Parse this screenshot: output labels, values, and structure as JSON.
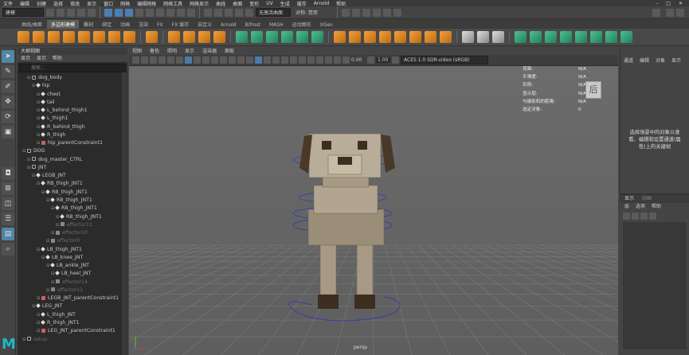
{
  "menubar": {
    "items": [
      "文件",
      "编辑",
      "创建",
      "选择",
      "修改",
      "显示",
      "窗口",
      "网格",
      "编辑网格",
      "网格工具",
      "网格显示",
      "曲线",
      "曲面",
      "变形",
      "UV",
      "生成",
      "缓存",
      "Arnold",
      "帮助"
    ]
  },
  "statusline": {
    "mode": "建模",
    "live_surface": "无激活曲面",
    "symmetry": "对称: 禁用"
  },
  "shelf": {
    "tabs": [
      "曲线/曲面",
      "多边形建模",
      "雕刻",
      "绑定",
      "动画",
      "渲染",
      "FX",
      "FX 缓存",
      "自定义",
      "Arnold",
      "Bifrost",
      "MASH",
      "运动图形",
      "XGen"
    ],
    "active_tab": "多边形建模"
  },
  "outliner": {
    "title": "大纲视图",
    "menu": [
      "显示",
      "显示",
      "帮助"
    ],
    "search_placeholder": "搜索...",
    "rows": [
      {
        "label": "dog_body",
        "depth": 2,
        "icon": "xf",
        "dim": false
      },
      {
        "label": "hip",
        "depth": 3,
        "icon": "joint",
        "dim": false
      },
      {
        "label": "chest",
        "depth": 4,
        "icon": "joint",
        "dim": false
      },
      {
        "label": "tail",
        "depth": 4,
        "icon": "joint",
        "dim": false
      },
      {
        "label": "L_behind_thigh1",
        "depth": 4,
        "icon": "joint",
        "dim": false
      },
      {
        "label": "L_thigh1",
        "depth": 4,
        "icon": "joint",
        "dim": false
      },
      {
        "label": "R_behind_thigh",
        "depth": 4,
        "icon": "joint",
        "dim": false
      },
      {
        "label": "R_thigh",
        "depth": 4,
        "icon": "joint",
        "dim": false
      },
      {
        "label": "hip_parentConstraint1",
        "depth": 4,
        "icon": "con",
        "dim": false
      },
      {
        "label": "DOG",
        "depth": 1,
        "icon": "xf",
        "dim": false
      },
      {
        "label": "dog_master_CTRL",
        "depth": 2,
        "icon": "xf",
        "dim": false
      },
      {
        "label": "JNT",
        "depth": 2,
        "icon": "xf",
        "dim": false
      },
      {
        "label": "LEGB_JNT",
        "depth": 3,
        "icon": "joint",
        "dim": false
      },
      {
        "label": "RB_thigh_JNT1",
        "depth": 4,
        "icon": "joint",
        "dim": false
      },
      {
        "label": "RB_thigh_JNT1",
        "depth": 5,
        "icon": "joint",
        "dim": false
      },
      {
        "label": "RB_thigh_JNT1",
        "depth": 6,
        "icon": "joint",
        "dim": false
      },
      {
        "label": "RB_thigh_JNT1",
        "depth": 7,
        "icon": "joint",
        "dim": false
      },
      {
        "label": "RB_thigh_JNT1",
        "depth": 8,
        "icon": "joint",
        "dim": false
      },
      {
        "label": "effector11",
        "depth": 8,
        "icon": "eff",
        "dim": true
      },
      {
        "label": "effector10",
        "depth": 7,
        "icon": "eff",
        "dim": true
      },
      {
        "label": "effector9",
        "depth": 6,
        "icon": "eff",
        "dim": true
      },
      {
        "label": "LB_thigh_JNT1",
        "depth": 4,
        "icon": "joint",
        "dim": false
      },
      {
        "label": "LB_knee_JNT",
        "depth": 5,
        "icon": "joint",
        "dim": false
      },
      {
        "label": "LB_ankle_JNT",
        "depth": 6,
        "icon": "joint",
        "dim": false
      },
      {
        "label": "LB_heel_JNT",
        "depth": 7,
        "icon": "joint",
        "dim": false
      },
      {
        "label": "effector14",
        "depth": 7,
        "icon": "eff",
        "dim": true
      },
      {
        "label": "effector13",
        "depth": 6,
        "icon": "eff",
        "dim": true
      },
      {
        "label": "LEGB_JNT_parentConstraint1",
        "depth": 4,
        "icon": "con",
        "dim": false
      },
      {
        "label": "LEG_JNT",
        "depth": 3,
        "icon": "joint",
        "dim": false
      },
      {
        "label": "L_thigh_JNT",
        "depth": 4,
        "icon": "joint",
        "dim": false
      },
      {
        "label": "R_thigh_JNT1",
        "depth": 4,
        "icon": "joint",
        "dim": false
      },
      {
        "label": "LEG_JNT_parentConstraint1",
        "depth": 4,
        "icon": "con",
        "dim": false
      },
      {
        "label": "setup",
        "depth": 1,
        "icon": "xf",
        "dim": true
      }
    ]
  },
  "viewport": {
    "menu": [
      "视图",
      "着色",
      "照明",
      "显示",
      "渲染器",
      "面板"
    ],
    "value_a": "0.00",
    "value_b": "1.00",
    "color_space": "ACES 1.0 SDR-video (sRGB)",
    "camera": "persp",
    "hud": [
      {
        "k": "背面:",
        "v": "N/A"
      },
      {
        "k": "平滑度:",
        "v": "N/A"
      },
      {
        "k": "实例:",
        "v": "N/A"
      },
      {
        "k": "显示层:",
        "v": "N/A"
      },
      {
        "k": "与摄影机的距离:",
        "v": "N/A"
      },
      {
        "k": "选定对象:",
        "v": "0"
      }
    ],
    "viewcube_label": "后"
  },
  "channelbox": {
    "tabs": [
      "通道",
      "编辑",
      "对象",
      "显示"
    ],
    "message": "选择场景中的对象以查看、编辑和设置通道(属性)上的关键帧"
  },
  "layers": {
    "tabs": [
      "显示",
      "动画"
    ],
    "menu": [
      "层",
      "选项",
      "帮助"
    ]
  },
  "app": {
    "logo_letter": "M"
  },
  "colors": {
    "accent": "#5285a6",
    "bg": "#444444",
    "outliner_bg": "#2b2b2b",
    "viewport_top": "#6c6c6c",
    "dog_body": "#a69a86",
    "dog_dark": "#3d2e22",
    "control_curve": "#3a3ea8"
  }
}
